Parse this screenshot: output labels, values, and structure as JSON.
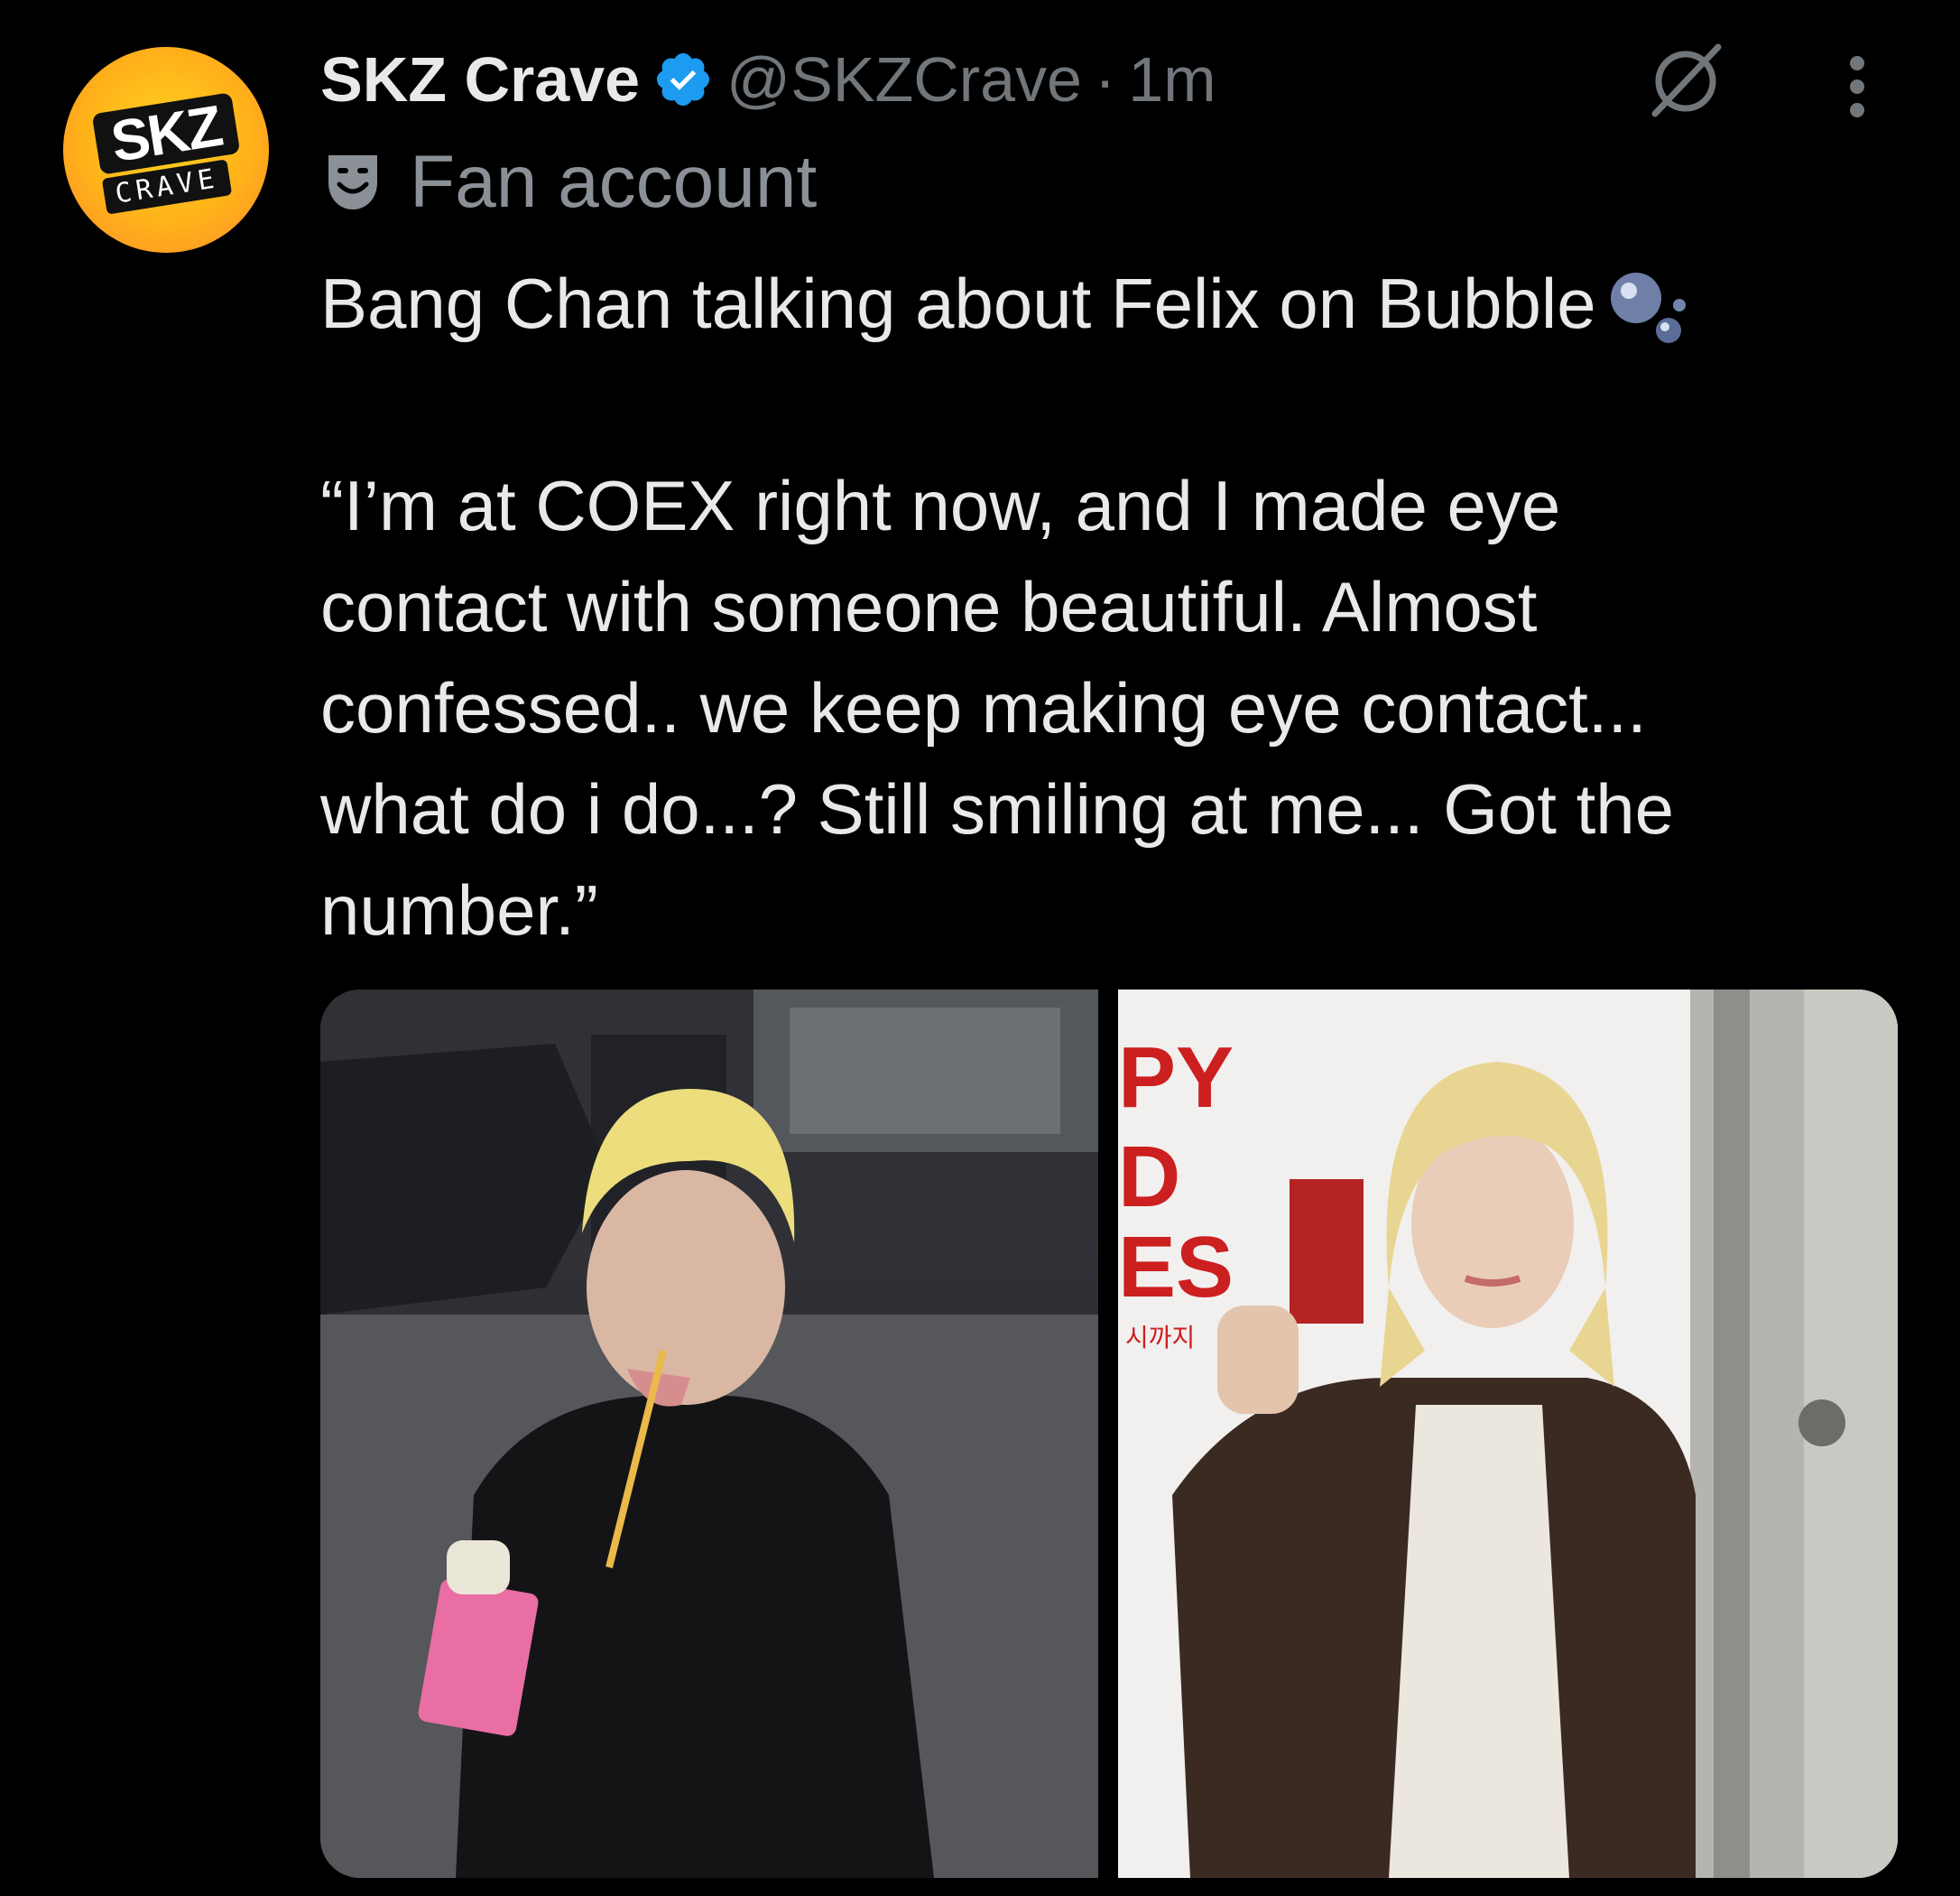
{
  "author": {
    "avatar_text": {
      "line1": "SKZ",
      "line2": "CRAVE"
    },
    "display_name": "SKZ Crave",
    "handle": "@SKZCrave",
    "separator": "·",
    "time": "1m",
    "label": "Fan account"
  },
  "tweet": {
    "line1": "Bang Chan talking about Felix on Bubble",
    "quote": "“I’m at COEX right now, and I made eye\ncontact with someone beautiful. Almost\nconfessed.. we keep making eye contact...\nwhat do i do...? Still smiling at me... Got the\nnumber.”"
  },
  "poster_text": {
    "line1": "PY",
    "line2": "D",
    "line3": "ES",
    "korean": "시까지"
  },
  "icons": {
    "verified": "verified-badge-icon",
    "grok": "grok-icon",
    "more": "more-options-icon",
    "mask": "theater-mask-icon",
    "bubble": "bubbles-emoji-icon"
  },
  "colors": {
    "background": "#000000",
    "text": "#e7e9ea",
    "secondary": "#71767b",
    "verified": "#1d9bf0",
    "avatar": "#ffc21e"
  }
}
